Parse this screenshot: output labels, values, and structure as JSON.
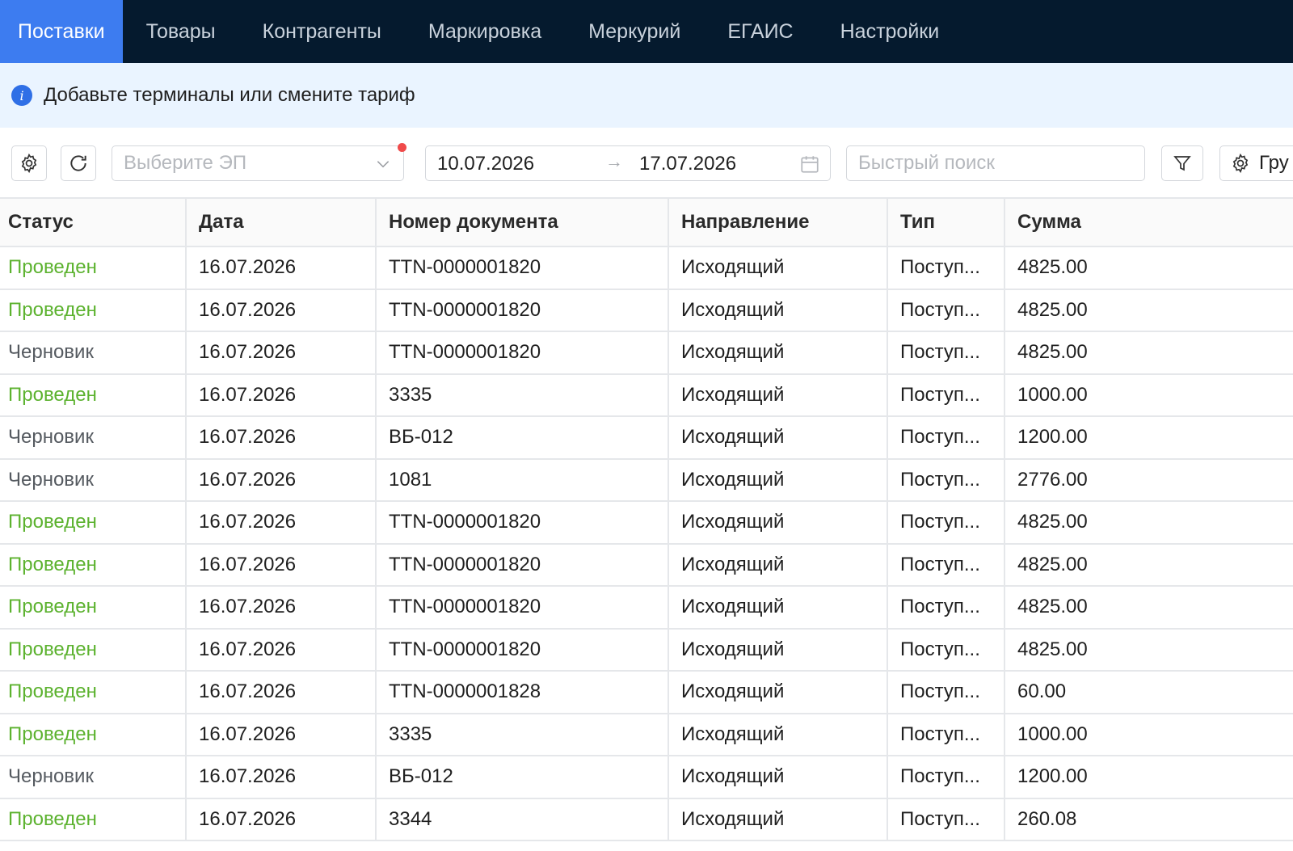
{
  "nav": {
    "tabs": [
      {
        "label": "Поставки",
        "active": true
      },
      {
        "label": "Товары"
      },
      {
        "label": "Контрагенты"
      },
      {
        "label": "Маркировка"
      },
      {
        "label": "Меркурий"
      },
      {
        "label": "ЕГАИС"
      },
      {
        "label": "Настройки"
      }
    ]
  },
  "banner": {
    "icon": "info-icon",
    "text": "Добавьте терминалы или смените тариф"
  },
  "toolbar": {
    "settings_icon": "gear-icon",
    "refresh_icon": "refresh-icon",
    "ep_select_placeholder": "Выберите ЭП",
    "date_from": "10.07.2026",
    "date_arrow": "→",
    "date_to": "17.07.2026",
    "search_placeholder": "Быстрый поиск",
    "filter_icon": "filter-icon",
    "group_label": "Гру"
  },
  "colors": {
    "nav_bg": "#051a2e",
    "nav_active": "#3d7cf0",
    "banner_bg": "#eaf4ff",
    "status_done": "#5cb22f",
    "status_draft": "#555a60",
    "notification_dot": "#f04a4a"
  },
  "table": {
    "columns": [
      "Статус",
      "Дата",
      "Номер документа",
      "Направление",
      "Тип",
      "Сумма"
    ],
    "rows": [
      [
        "Проведен",
        "16.07.2026",
        "TTN-0000001820",
        "Исходящий",
        "Поступ...",
        "4825.00"
      ],
      [
        "Проведен",
        "16.07.2026",
        "TTN-0000001820",
        "Исходящий",
        "Поступ...",
        "4825.00"
      ],
      [
        "Черновик",
        "16.07.2026",
        "TTN-0000001820",
        "Исходящий",
        "Поступ...",
        "4825.00"
      ],
      [
        "Проведен",
        "16.07.2026",
        "3335",
        "Исходящий",
        "Поступ...",
        "1000.00"
      ],
      [
        "Черновик",
        "16.07.2026",
        "ВБ-012",
        "Исходящий",
        "Поступ...",
        "1200.00"
      ],
      [
        "Черновик",
        "16.07.2026",
        "1081",
        "Исходящий",
        "Поступ...",
        "2776.00"
      ],
      [
        "Проведен",
        "16.07.2026",
        "TTN-0000001820",
        "Исходящий",
        "Поступ...",
        "4825.00"
      ],
      [
        "Проведен",
        "16.07.2026",
        "TTN-0000001820",
        "Исходящий",
        "Поступ...",
        "4825.00"
      ],
      [
        "Проведен",
        "16.07.2026",
        "TTN-0000001820",
        "Исходящий",
        "Поступ...",
        "4825.00"
      ],
      [
        "Проведен",
        "16.07.2026",
        "TTN-0000001820",
        "Исходящий",
        "Поступ...",
        "4825.00"
      ],
      [
        "Проведен",
        "16.07.2026",
        "TTN-0000001828",
        "Исходящий",
        "Поступ...",
        "60.00"
      ],
      [
        "Проведен",
        "16.07.2026",
        "3335",
        "Исходящий",
        "Поступ...",
        "1000.00"
      ],
      [
        "Черновик",
        "16.07.2026",
        "ВБ-012",
        "Исходящий",
        "Поступ...",
        "1200.00"
      ],
      [
        "Проведен",
        "16.07.2026",
        "3344",
        "Исходящий",
        "Поступ...",
        "260.08"
      ]
    ]
  }
}
